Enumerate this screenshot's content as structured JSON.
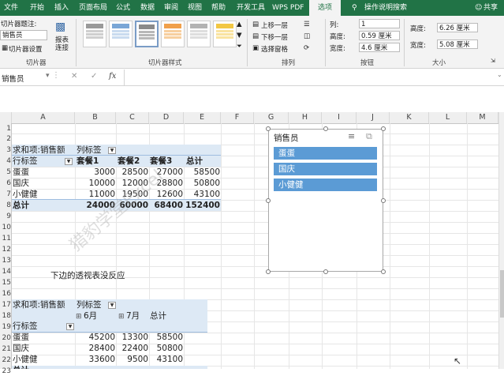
{
  "ribbon": {
    "tabs": [
      "文件",
      "开始",
      "插入",
      "页面布局",
      "公式",
      "数据",
      "审阅",
      "视图",
      "帮助",
      "开发工具",
      "WPS PDF",
      "选项"
    ],
    "active_tab": "选项",
    "tell_me": "操作说明搜索",
    "share": "共享",
    "slicer_caption_label": "切片器题注:",
    "slicer_caption_value": "销售员",
    "slicer_settings": "切片器设置",
    "report_connections": "报表\n连接",
    "group_slicer": "切片器",
    "group_styles": "切片器样式",
    "bring_forward": "上移一层",
    "send_backward": "下移一层",
    "selection_pane": "选择窗格",
    "group_arrange": "排列",
    "columns_label": "列:",
    "columns_value": "1",
    "height_label": "高度:",
    "height_value": "0.59 厘米",
    "width_label": "宽度:",
    "width_value": "4.6 厘米",
    "group_buttons": "按钮",
    "size_height_label": "高度:",
    "size_height_value": "6.26 厘米",
    "size_width_label": "宽度:",
    "size_width_value": "5.08 厘米",
    "group_size": "大小",
    "accent": "#217346"
  },
  "formula_bar": {
    "name_box": "销售员",
    "fx": "fx",
    "content": ""
  },
  "columns": [
    "A",
    "B",
    "C",
    "D",
    "E",
    "F",
    "G",
    "H",
    "I",
    "J",
    "K",
    "L",
    "M"
  ],
  "rows": [
    "1",
    "2",
    "3",
    "4",
    "5",
    "6",
    "7",
    "8",
    "9",
    "10",
    "11",
    "12",
    "13",
    "14",
    "15",
    "16",
    "17",
    "18",
    "19",
    "20",
    "21",
    "22",
    "23"
  ],
  "pivot1": {
    "title": "求和项:销售额",
    "col_label": "列标签",
    "row_label": "行标签",
    "headers": [
      "套餐1",
      "套餐2",
      "套餐3",
      "总计"
    ],
    "rows": [
      {
        "name": "蛋蛋",
        "values": [
          "3000",
          "28500",
          "27000",
          "58500"
        ]
      },
      {
        "name": "国庆",
        "values": [
          "10000",
          "12000",
          "28800",
          "50800"
        ]
      },
      {
        "name": "小健健",
        "values": [
          "11000",
          "19500",
          "12600",
          "43100"
        ]
      }
    ],
    "total": {
      "name": "总计",
      "values": [
        "24000",
        "60000",
        "68400",
        "152400"
      ]
    }
  },
  "note": "下边的透视表没反应",
  "pivot2": {
    "title": "求和项:销售额",
    "col_label": "列标签",
    "row_label": "行标签",
    "headers": [
      "6月",
      "7月",
      "总计"
    ],
    "rows": [
      {
        "name": "蛋蛋",
        "values": [
          "45200",
          "13300",
          "58500"
        ]
      },
      {
        "name": "国庆",
        "values": [
          "28400",
          "22400",
          "50800"
        ]
      },
      {
        "name": "小健健",
        "values": [
          "33600",
          "9500",
          "43100"
        ]
      }
    ],
    "total_partial": "总计"
  },
  "slicer": {
    "title": "销售员",
    "items": [
      "蛋蛋",
      "国庆",
      "小健健"
    ],
    "item_color": "#5b9bd5"
  },
  "watermark": "猎豹学堂Excel"
}
